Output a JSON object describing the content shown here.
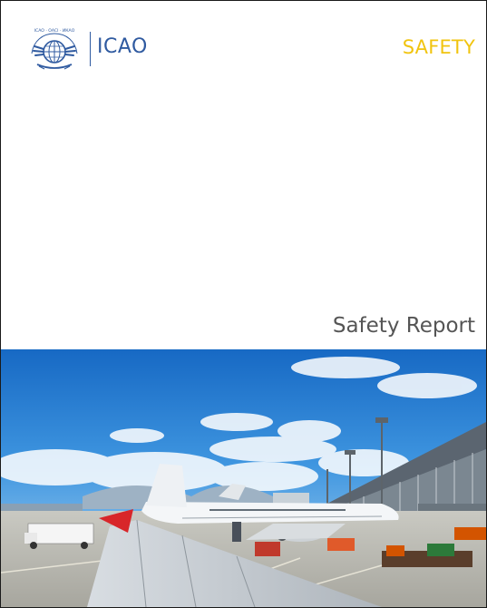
{
  "header": {
    "org_name": "ICAO",
    "category": "SAFETY",
    "logo_text": "ICAO · OACI · ИКАО"
  },
  "cover": {
    "title": "Safety Report"
  },
  "colors": {
    "brand_blue": "#2f5aa0",
    "category_yellow": "#f1c40f",
    "title_gray": "#555555"
  },
  "icons": {
    "logo": "icao-emblem-icon"
  }
}
